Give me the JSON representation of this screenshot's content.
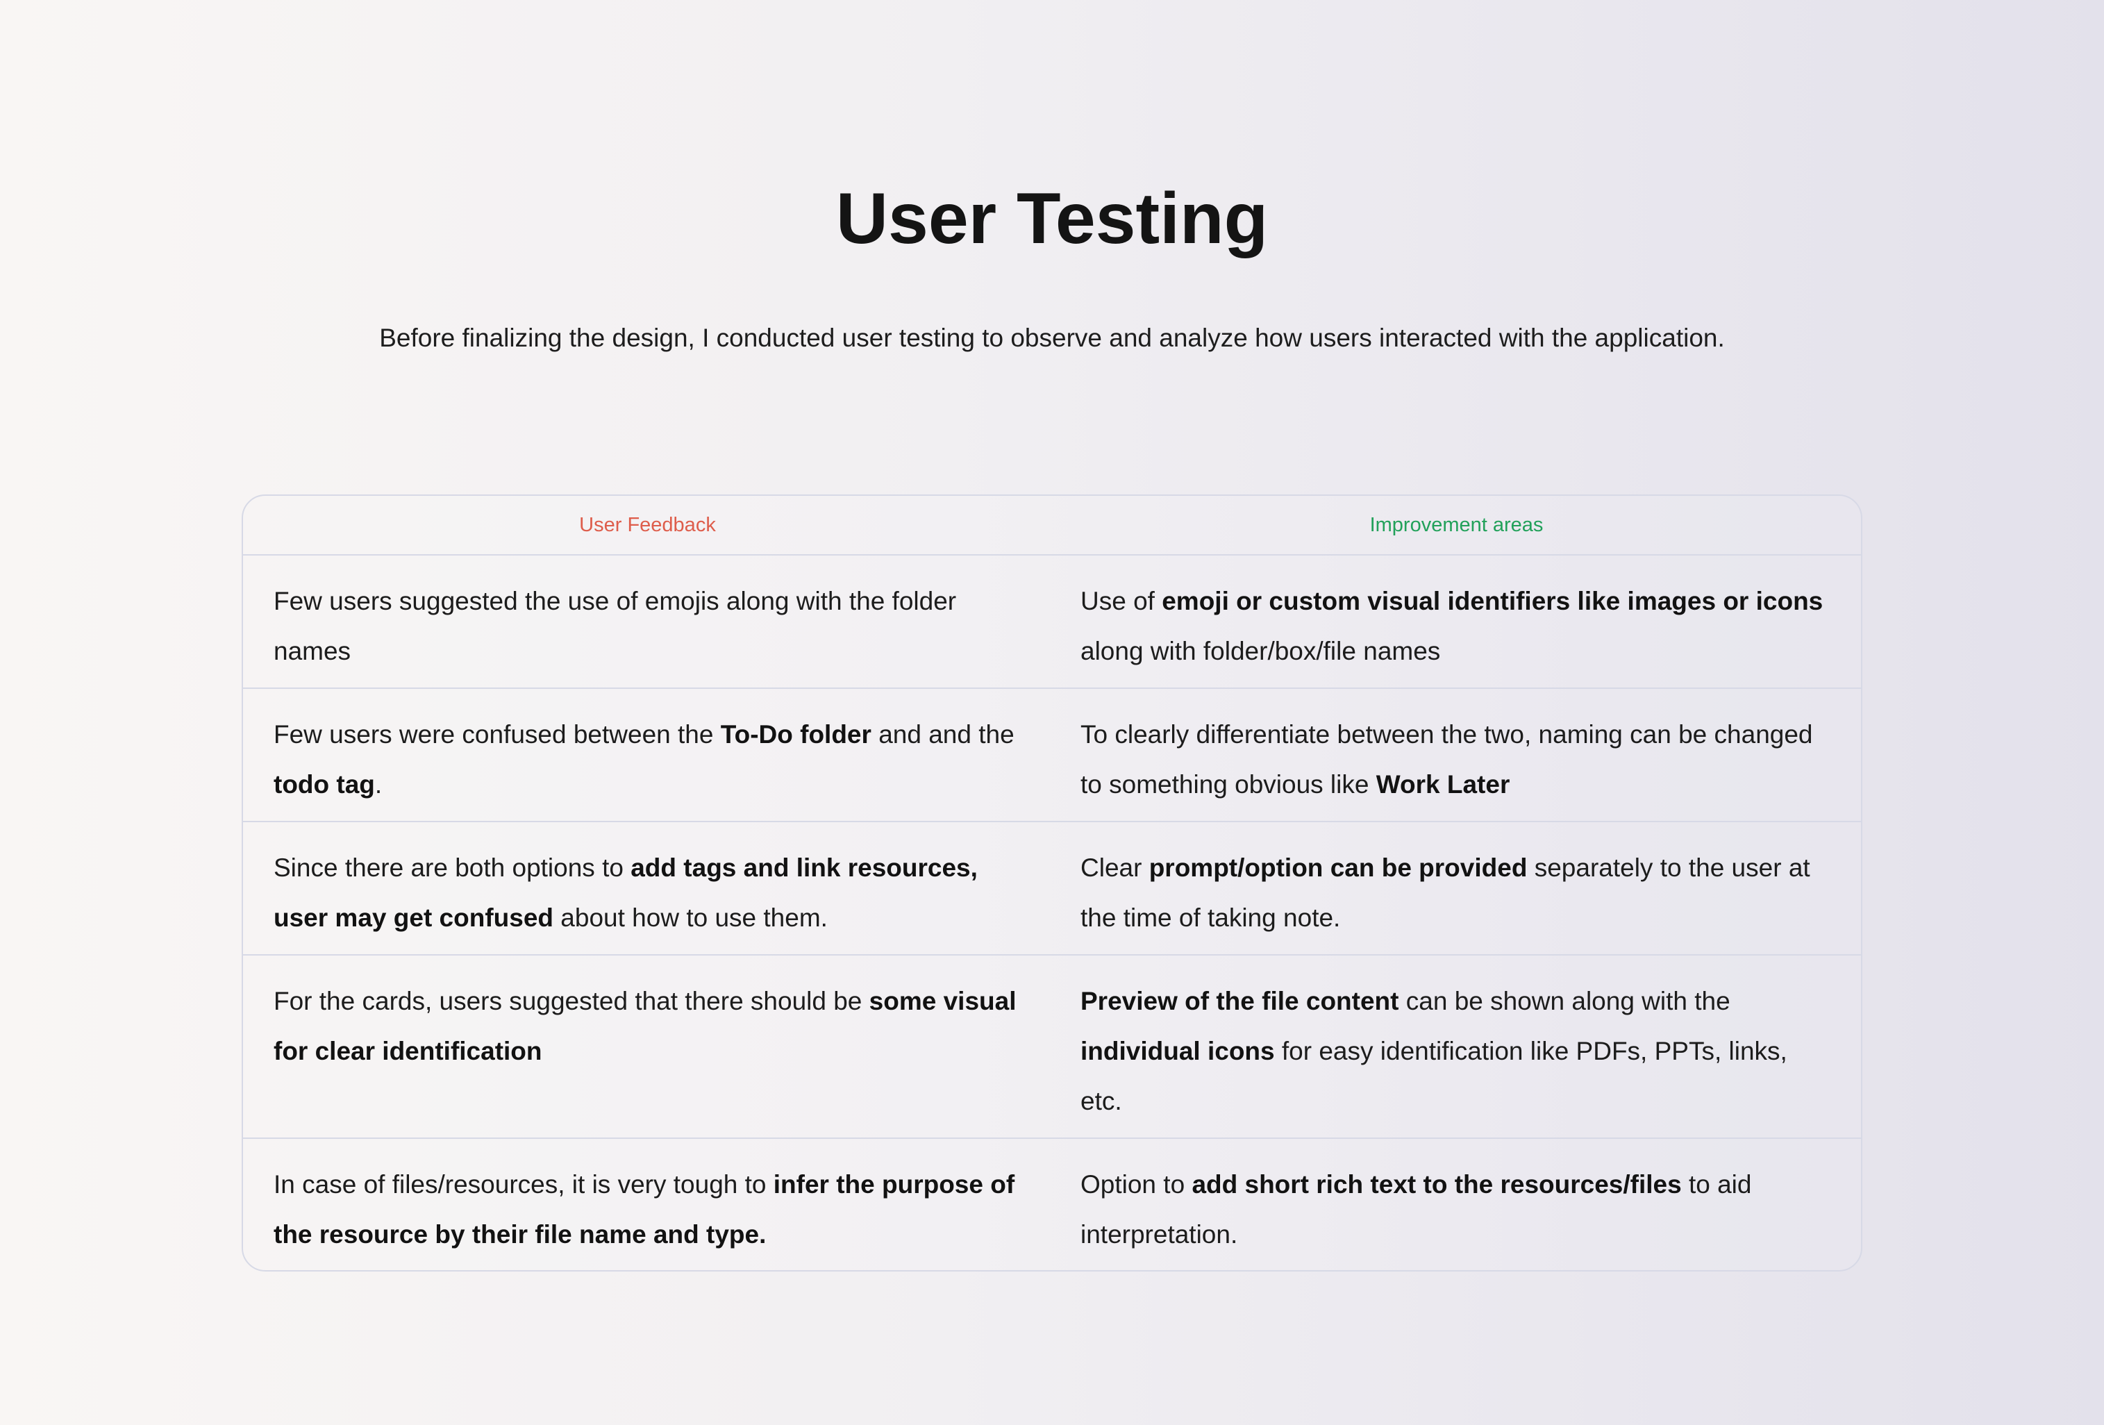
{
  "page": {
    "title": "User Testing",
    "subtitle": "Before finalizing the design, I conducted user testing to observe and analyze how users interacted with the application."
  },
  "table": {
    "headers": {
      "feedback": "User Feedback",
      "improvement": "Improvement areas"
    },
    "header_colors": {
      "feedback": "#de5d4b",
      "improvement": "#22a15a"
    },
    "rows": [
      {
        "feedback": [
          {
            "text": "Few users suggested the use of emojis along with the folder names",
            "bold": false
          }
        ],
        "improvement": [
          {
            "text": "Use of ",
            "bold": false
          },
          {
            "text": "emoji or custom visual identifiers like images or icons",
            "bold": true
          },
          {
            "text": " along with folder/box/file names",
            "bold": false
          }
        ]
      },
      {
        "feedback": [
          {
            "text": "Few users were confused between the ",
            "bold": false
          },
          {
            "text": "To-Do folder",
            "bold": true
          },
          {
            "text": " and and the ",
            "bold": false
          },
          {
            "text": "todo tag",
            "bold": true
          },
          {
            "text": ".",
            "bold": false
          }
        ],
        "improvement": [
          {
            "text": "To clearly differentiate between the two, naming can be changed to something obvious like ",
            "bold": false
          },
          {
            "text": "Work Later",
            "bold": true
          }
        ]
      },
      {
        "feedback": [
          {
            "text": "Since there are both options to ",
            "bold": false
          },
          {
            "text": "add tags and link resources, user may get confused",
            "bold": true
          },
          {
            "text": " about how to use them.",
            "bold": false
          }
        ],
        "improvement": [
          {
            "text": "Clear ",
            "bold": false
          },
          {
            "text": "prompt/option can be provided",
            "bold": true
          },
          {
            "text": " separately to the user at the time of taking note.",
            "bold": false
          }
        ]
      },
      {
        "feedback": [
          {
            "text": "For the cards, users suggested that there should be ",
            "bold": false
          },
          {
            "text": "some visual for clear identification",
            "bold": true
          }
        ],
        "improvement": [
          {
            "text": "Preview of the file content",
            "bold": true
          },
          {
            "text": " can be shown along with the ",
            "bold": false
          },
          {
            "text": "individual icons",
            "bold": true
          },
          {
            "text": " for easy identification like PDFs, PPTs, links, etc.",
            "bold": false
          }
        ]
      },
      {
        "feedback": [
          {
            "text": "In case of files/resources, it is very tough to ",
            "bold": false
          },
          {
            "text": "infer the purpose of the resource by their file name and type.",
            "bold": true
          }
        ],
        "improvement": [
          {
            "text": "Option to ",
            "bold": false
          },
          {
            "text": "add short rich text to the resources/files",
            "bold": true
          },
          {
            "text": " to aid interpretation.",
            "bold": false
          }
        ]
      }
    ]
  }
}
